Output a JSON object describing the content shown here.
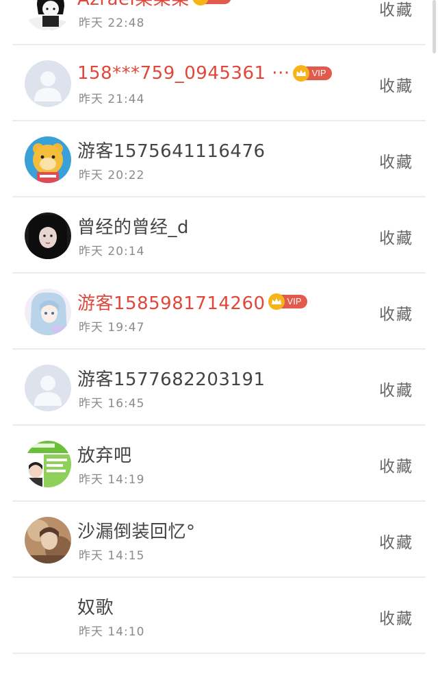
{
  "contacts": [
    {
      "name": "Azrael染柒柒",
      "vip": true,
      "time": "昨天 22:48",
      "action": "收藏",
      "avatar": "cartoon-boy"
    },
    {
      "name": "158***759_0945361 ···",
      "vip": true,
      "time": "昨天 21:44",
      "action": "收藏",
      "avatar": "default"
    },
    {
      "name": "游客1575641116476",
      "vip": false,
      "time": "昨天 20:22",
      "action": "收藏",
      "avatar": "yellow-bear"
    },
    {
      "name": "曾经的曾经_d",
      "vip": false,
      "time": "昨天 20:14",
      "action": "收藏",
      "avatar": "dark-girl"
    },
    {
      "name": "游客1585981714260",
      "vip": true,
      "time": "昨天 19:47",
      "action": "收藏",
      "avatar": "anime-girl"
    },
    {
      "name": "游客1577682203191",
      "vip": false,
      "time": "昨天 16:45",
      "action": "收藏",
      "avatar": "default"
    },
    {
      "name": "放弃吧",
      "vip": false,
      "time": "昨天 14:19",
      "action": "收藏",
      "avatar": "green-poster"
    },
    {
      "name": "沙漏倒装回忆°",
      "vip": false,
      "time": "昨天 14:15",
      "action": "收藏",
      "avatar": "blurry-photo"
    },
    {
      "name": "奴歌",
      "vip": false,
      "time": "昨天 14:10",
      "action": "收藏",
      "avatar": "none"
    }
  ],
  "vip_label": "VIP",
  "colors": {
    "vip_name": "#e0473a",
    "vip_badge": "#e25a4c",
    "crown": "#f4b41a",
    "name": "#444444",
    "time": "#8a8a8a"
  }
}
